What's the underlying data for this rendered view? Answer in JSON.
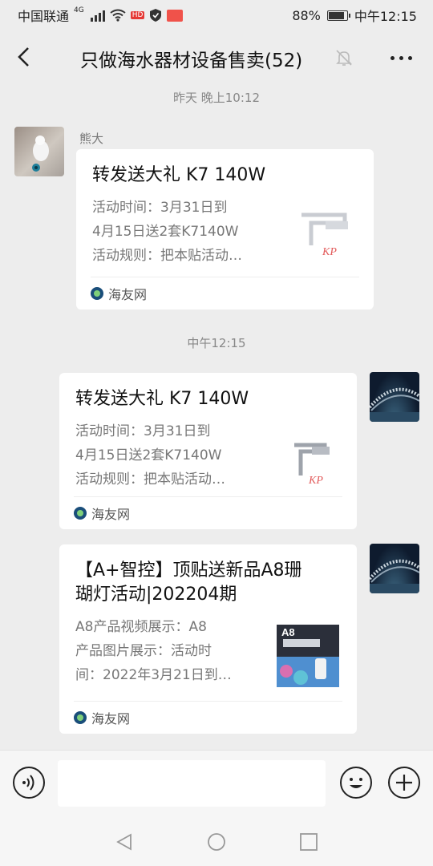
{
  "status": {
    "carrier": "中国联通",
    "network": "4G",
    "hd_badge": "HD",
    "battery": "88%",
    "time": "中午12:15"
  },
  "nav": {
    "title": "只做海水器材设备售卖(52)"
  },
  "messages": {
    "time1": "昨天 晚上10:12",
    "sender1": "熊大",
    "card1": {
      "title": "转发送大礼 K7 140W",
      "desc1": "活动时间：3月31日到",
      "desc2": "4月15日送2套K7140W",
      "desc3": "活动规则：把本贴活动…",
      "source": "海友网"
    },
    "time2": "中午12:15",
    "card2": {
      "title": "转发送大礼 K7 140W",
      "desc1": "活动时间：3月31日到",
      "desc2": "4月15日送2套K7140W",
      "desc3": "活动规则：把本贴活动…",
      "source": "海友网"
    },
    "card3": {
      "title1": "【A+智控】顶贴送新品A8珊",
      "title2": "瑚灯活动|202204期",
      "desc1": "A8产品视频展示：A8",
      "desc2": "产品图片展示：活动时",
      "desc3": "间：2022年3月21日到…",
      "thumb_label": "A8",
      "source": "海友网"
    }
  },
  "thumbs": {
    "lamp_brand": "KP"
  }
}
